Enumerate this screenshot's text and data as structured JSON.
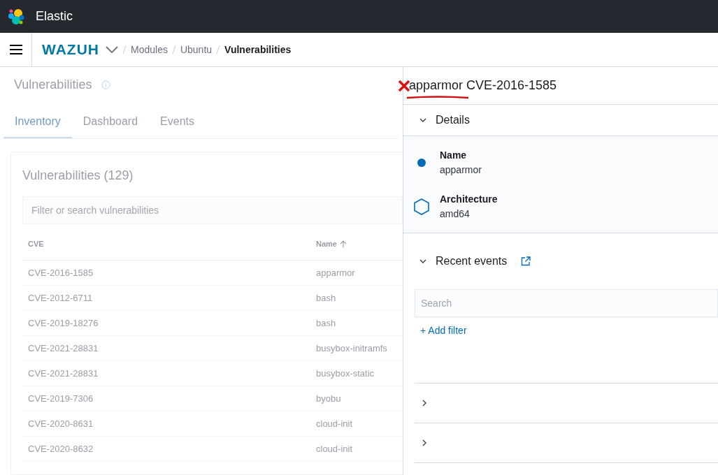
{
  "app": {
    "title": "Elastic"
  },
  "breadcrumbs": {
    "brand": "WAZUH",
    "items": [
      {
        "label": "Modules",
        "current": false
      },
      {
        "label": "Ubuntu",
        "current": false
      },
      {
        "label": "Vulnerabilities",
        "current": true
      }
    ]
  },
  "page": {
    "title": "Vulnerabilities",
    "tabs": [
      {
        "label": "Inventory",
        "selected": true
      },
      {
        "label": "Dashboard",
        "selected": false
      },
      {
        "label": "Events",
        "selected": false
      }
    ],
    "panel": {
      "title": "Vulnerabilities (129)",
      "search": {
        "placeholder": "Filter or search vulnerabilities"
      },
      "columns": [
        {
          "label": "CVE",
          "sorted": false
        },
        {
          "label": "Name",
          "sorted": true
        }
      ],
      "rows": [
        [
          "CVE-2016-1585",
          "apparmor"
        ],
        [
          "CVE-2012-6711",
          "bash"
        ],
        [
          "CVE-2019-18276",
          "bash"
        ],
        [
          "CVE-2021-28831",
          "busybox-initramfs"
        ],
        [
          "CVE-2021-28831",
          "busybox-static"
        ],
        [
          "CVE-2019-7306",
          "byobu"
        ],
        [
          "CVE-2020-8631",
          "cloud-init"
        ],
        [
          "CVE-2020-8632",
          "cloud-init"
        ]
      ]
    }
  },
  "flyout": {
    "title_name": "apparmor",
    "title_id": "CVE-2016-1585",
    "details": {
      "title": "Details",
      "expanded": true,
      "items": [
        {
          "kind": "dot",
          "label": "Name",
          "value": "apparmor"
        },
        {
          "kind": "hexagon",
          "label": "Architecture",
          "value": "amd64"
        }
      ]
    },
    "recent_events": {
      "title": "Recent events",
      "expanded": true,
      "search": {
        "placeholder": "Search"
      },
      "add_filter": "+ Add filter",
      "rows": [
        {
          "expanded": false
        },
        {
          "expanded": false
        }
      ]
    }
  }
}
